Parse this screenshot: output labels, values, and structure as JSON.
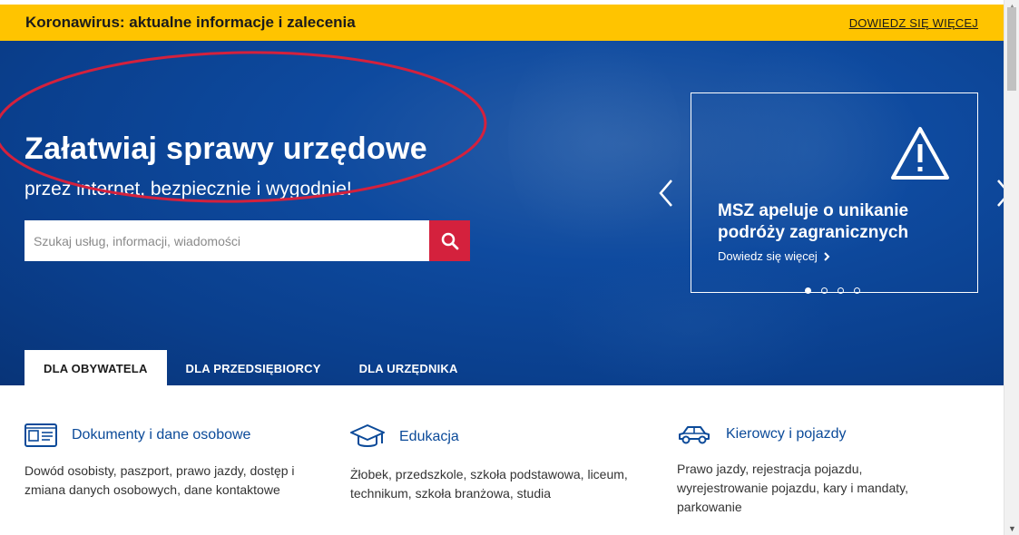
{
  "alert": {
    "title": "Koronawirus: aktualne informacje i zalecenia",
    "link": "DOWIEDZ SIĘ WIĘCEJ"
  },
  "hero": {
    "heading": "Załatwiaj sprawy urzędowe",
    "subheading": "przez internet, bezpiecznie i wygodnie!",
    "search": {
      "placeholder": "Szukaj usług, informacji, wiadomości",
      "button_icon": "search-icon"
    },
    "annotation_color": "#d4213d"
  },
  "carousel": {
    "card_title": "MSZ apeluje o unikanie podróży zagranicznych",
    "card_link": "Dowiedz się więcej",
    "card_icon": "warning-icon",
    "slides": 4,
    "active_slide": 1
  },
  "tabs": [
    {
      "label": "DLA OBYWATELA",
      "active": true
    },
    {
      "label": "DLA PRZEDSIĘBIORCY",
      "active": false
    },
    {
      "label": "DLA URZĘDNIKA",
      "active": false
    }
  ],
  "categories": [
    {
      "icon": "id-card-icon",
      "title": "Dokumenty i dane osobowe",
      "description": "Dowód osobisty, paszport, prawo jazdy, dostęp i zmiana danych osobowych, dane kontaktowe"
    },
    {
      "icon": "graduation-cap-icon",
      "title": "Edukacja",
      "description": "Żłobek, przedszkole, szkoła podstawowa, liceum, technikum, szkoła branżowa, studia"
    },
    {
      "icon": "car-icon",
      "title": "Kierowcy i pojazdy",
      "description": "Prawo jazdy, rejestracja pojazdu, wyrejestrowanie pojazdu, kary i mandaty, parkowanie"
    }
  ],
  "colors": {
    "alert_bg": "#ffc400",
    "hero_blue": "#0e4a9f",
    "accent_red": "#d4213d",
    "link_blue": "#0b4a99"
  }
}
